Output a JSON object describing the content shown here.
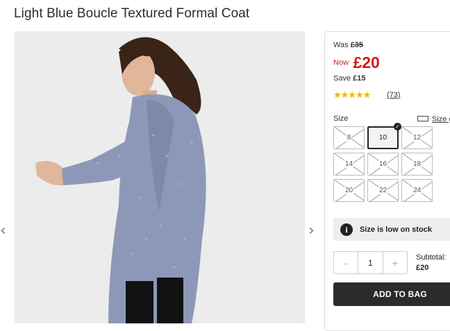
{
  "product": {
    "title": "Light Blue Boucle Textured Formal Coat"
  },
  "pricing": {
    "was_label": "Was",
    "was_price": "£35",
    "now_label": "Now",
    "now_price": "£20",
    "save_label": "Save",
    "save_amount": "£15"
  },
  "rating": {
    "stars": "★★★★★",
    "value": 5,
    "reviews": "(73)",
    "star_color": "#f0b400"
  },
  "size": {
    "label": "Size",
    "guide_label": "Size guide",
    "options": [
      {
        "label": "8",
        "state": "out-of-stock"
      },
      {
        "label": "10",
        "state": "selected"
      },
      {
        "label": "12",
        "state": "out-of-stock"
      },
      {
        "label": "14",
        "state": "out-of-stock"
      },
      {
        "label": "16",
        "state": "out-of-stock"
      },
      {
        "label": "18",
        "state": "out-of-stock"
      },
      {
        "label": "20",
        "state": "out-of-stock"
      },
      {
        "label": "22",
        "state": "out-of-stock"
      },
      {
        "label": "24",
        "state": "out-of-stock"
      }
    ]
  },
  "stock": {
    "message": "Size is low on stock",
    "icon": "info-icon"
  },
  "quantity": {
    "minus": "-",
    "value": "1",
    "plus": "+"
  },
  "subtotal": {
    "label": "Subtotal:",
    "value": "£20"
  },
  "cart": {
    "add_label": "ADD TO BAG"
  },
  "gallery": {
    "prev_icon": "chevron-left-icon",
    "next_icon": "chevron-right-icon",
    "prev_glyph": "‹",
    "next_glyph": "›"
  },
  "colors": {
    "price_red": "#d11a1a",
    "button_dark": "#2b2b2b",
    "coat_blue": "#8d98b8"
  }
}
